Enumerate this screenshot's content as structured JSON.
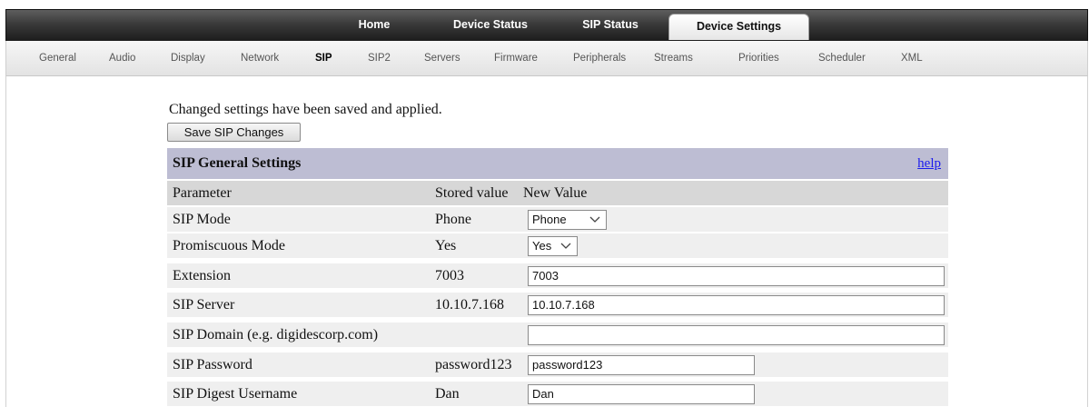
{
  "top_nav": {
    "tabs": [
      {
        "label": "Home"
      },
      {
        "label": "Device Status"
      },
      {
        "label": "SIP Status"
      },
      {
        "label": "Device Settings",
        "active": true
      }
    ]
  },
  "sub_nav": {
    "items": [
      {
        "label": "General"
      },
      {
        "label": "Audio"
      },
      {
        "label": "Display"
      },
      {
        "label": "Network"
      },
      {
        "label": "SIP",
        "active": true
      },
      {
        "label": "SIP2"
      },
      {
        "label": "Servers"
      },
      {
        "label": "Firmware"
      },
      {
        "label": "Peripherals"
      },
      {
        "label": "Streams"
      },
      {
        "label": "Priorities"
      },
      {
        "label": "Scheduler"
      },
      {
        "label": "XML"
      }
    ]
  },
  "status_message": "Changed settings have been saved and applied.",
  "save_button_label": "Save SIP Changes",
  "section": {
    "title": "SIP General Settings",
    "help_label": "help",
    "columns": {
      "parameter": "Parameter",
      "stored": "Stored value",
      "new": "New Value"
    },
    "rows": [
      {
        "parameter": "SIP Mode",
        "stored": "Phone",
        "control": "select",
        "value": "Phone"
      },
      {
        "parameter": "Promiscuous Mode",
        "stored": "Yes",
        "control": "select",
        "value": "Yes"
      },
      {
        "parameter": "Extension",
        "stored": "7003",
        "control": "text",
        "value": "7003"
      },
      {
        "parameter": "SIP Server",
        "stored": "10.10.7.168",
        "control": "text",
        "value": "10.10.7.168"
      },
      {
        "parameter": "SIP Domain (e.g. digidescorp.com)",
        "stored": "",
        "control": "text",
        "value": ""
      },
      {
        "parameter": "SIP Password",
        "stored": "password123",
        "control": "text",
        "value": "password123"
      },
      {
        "parameter": "SIP Digest Username",
        "stored": "Dan",
        "control": "text",
        "value": "Dan"
      }
    ]
  },
  "colors": {
    "section_header_bg": "#bdbdd3",
    "column_header_bg": "#d7d7d7",
    "row_bg": "#efefef",
    "link": "#1a1aee"
  }
}
